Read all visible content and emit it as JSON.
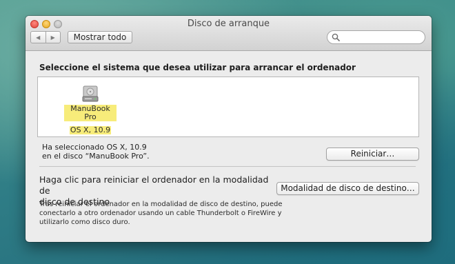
{
  "window": {
    "title": "Disco de arranque"
  },
  "toolbar": {
    "back_icon": "chevron-left-icon",
    "forward_icon": "chevron-right-icon",
    "show_all_label": "Mostrar todo",
    "search_placeholder": "",
    "search_icon": "magnifier-icon"
  },
  "main": {
    "heading": "Seleccione el sistema que desea utilizar para arrancar el ordenador",
    "disks": [
      {
        "icon": "hard-drive-icon",
        "name_line1": "ManuBook Pro",
        "name_line2": "OS X, 10.9",
        "selected": true
      }
    ],
    "selection_line1": "Ha seleccionado OS X, 10.9",
    "selection_line2": "en el disco “ManuBook Pro”.",
    "restart_label": "Reiniciar…",
    "target_heading_line1": "Haga clic para reiniciar el ordenador en la modalidad de",
    "target_heading_line2": "disco de destino",
    "target_button_label": "Modalidad de disco de destino…",
    "target_desc_line1": "Tras reiniciar el ordenador en la modalidad de disco de destino, puede",
    "target_desc_line2": "conectarlo a otro ordenador usando un cable Thunderbolt o FireWire y",
    "target_desc_line3": "utilizarlo como disco duro."
  },
  "colors": {
    "selection_highlight": "#f7ec7a",
    "window_bg": "#ececec"
  }
}
